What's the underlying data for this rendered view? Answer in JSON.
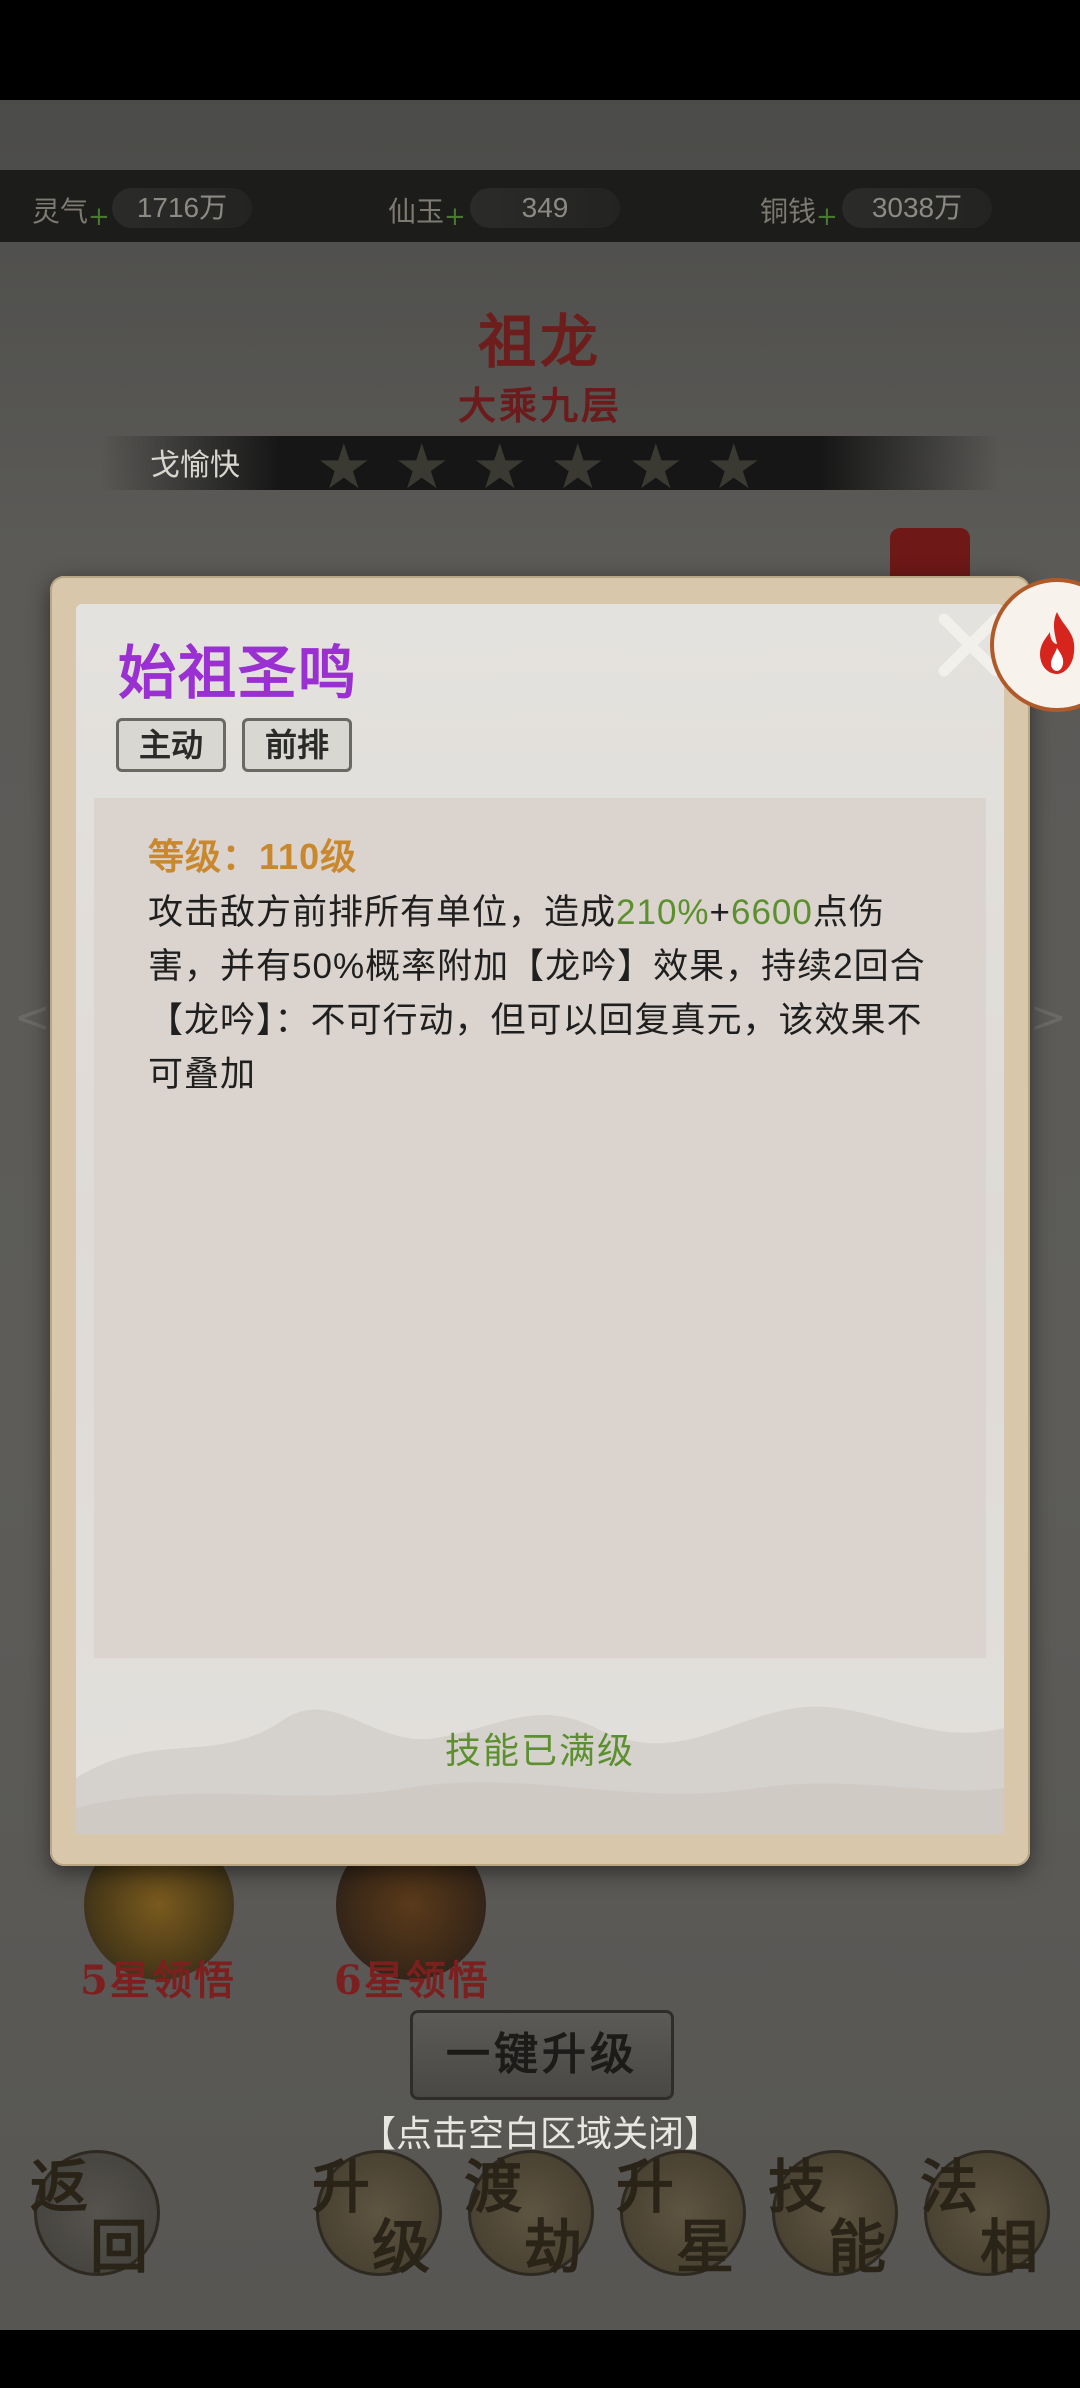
{
  "resources": [
    {
      "label": "灵气",
      "plus": "+",
      "value": "1716万"
    },
    {
      "label": "仙玉",
      "plus": "+",
      "value": "349"
    },
    {
      "label": "铜钱",
      "plus": "+",
      "value": "3038万"
    }
  ],
  "hero": {
    "name": "祖龙",
    "rank": "大乘九层",
    "strip_text": "戈愉快"
  },
  "background_skills": [
    {
      "label": "5星领悟"
    },
    {
      "label": "6星领悟"
    }
  ],
  "upgrade_button": "一键升级",
  "close_hint": "【点击空白区域关闭】",
  "nav": [
    {
      "chars": [
        "返",
        "回"
      ]
    },
    {
      "chars": [
        "升",
        "级"
      ]
    },
    {
      "chars": [
        "渡",
        "劫"
      ]
    },
    {
      "chars": [
        "升",
        "星"
      ]
    },
    {
      "chars": [
        "技",
        "能"
      ]
    },
    {
      "chars": [
        "法",
        "相"
      ]
    }
  ],
  "popup": {
    "title": "始祖圣鸣",
    "tags": [
      "主动",
      "前排"
    ],
    "level_label": "等级：",
    "level_value": "110级",
    "desc": {
      "p1": "攻击敌方前排所有单位，造成",
      "pct": "210%",
      "plus": "+",
      "flat": "6600",
      "p2": "点伤害，并有",
      "chance": "50%",
      "p3": "概率附加【龙吟】效果，持续",
      "turns": "2",
      "p4": "回合【龙吟】：不可行动，但可以回复真元，该效果不可叠加"
    },
    "maxed": "技能已满级",
    "colors": {
      "title": "#9a2fd2",
      "level": "#c9882e",
      "highlight": "#5c8f2e"
    }
  }
}
